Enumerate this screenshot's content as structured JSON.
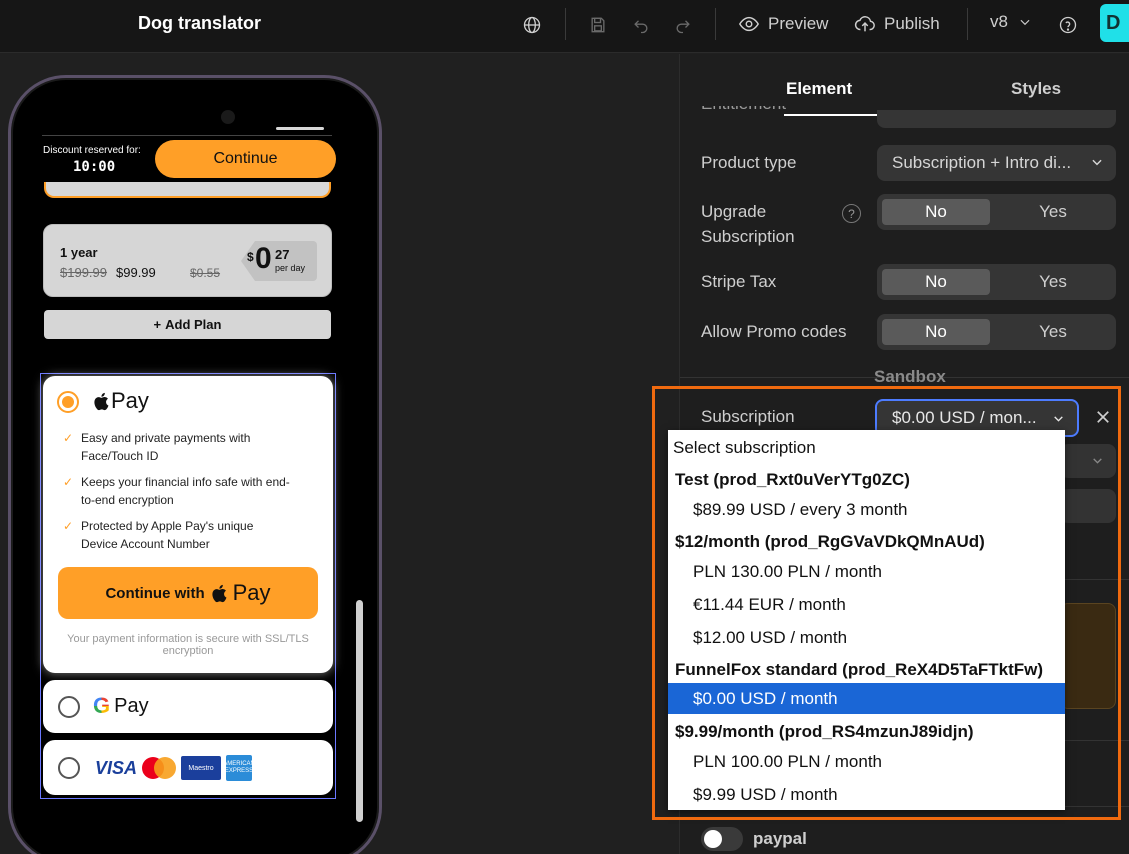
{
  "topbar": {
    "title": "Dog translator",
    "preview_label": "Preview",
    "publish_label": "Publish",
    "version": "v8",
    "avatar_initial": "D"
  },
  "phone": {
    "discount_label": "Discount reserved for:",
    "timer": "10:00",
    "continue_label": "Continue",
    "plan": {
      "name": "1 year",
      "old_price": "$199.99",
      "new_price": "$99.99",
      "old_per_day": "$0.55",
      "currency": "$",
      "price_int": "0",
      "price_dec": "27",
      "per_day": "per day"
    },
    "add_plan_label": "Add Plan",
    "apple_pay": {
      "logo_text": "Pay",
      "bullets": [
        "Easy and private payments with Face/Touch ID",
        "Keeps your financial info safe with end-to-end encryption",
        "Protected by Apple Pay's unique Device Account Number"
      ],
      "button_label": "Continue with",
      "button_pay": "Pay",
      "secure_note": "Your payment information is secure with SSL/TLS encryption"
    },
    "google_pay": {
      "logo_g": "G",
      "logo_text": "Pay"
    },
    "cards": {
      "visa": "VISA",
      "maestro": "Maestro",
      "amex": "AMERICAN EXPRESS"
    }
  },
  "panel": {
    "tabs": [
      "Element",
      "Styles"
    ],
    "cut_label": "Entitlement",
    "rows": {
      "product_type": {
        "label": "Product type",
        "value": "Subscription + Intro di..."
      },
      "upgrade": {
        "label": "Upgrade Subscription",
        "no": "No",
        "yes": "Yes"
      },
      "stripe_tax": {
        "label": "Stripe Tax",
        "no": "No",
        "yes": "Yes"
      },
      "promo": {
        "label": "Allow Promo codes",
        "no": "No",
        "yes": "Yes"
      }
    },
    "sandbox_label": "Sandbox",
    "subscription": {
      "label": "Subscription",
      "value": "$0.00 USD / mon..."
    },
    "paypal_label": "paypal"
  },
  "dropdown": {
    "items": [
      {
        "kind": "placeholder",
        "text": "Select subscription"
      },
      {
        "kind": "group",
        "text": "Test (prod_Rxt0uVerYTg0ZC)"
      },
      {
        "kind": "option",
        "text": "$89.99 USD / every 3 month"
      },
      {
        "kind": "group",
        "text": "$12/month (prod_RgGVaVDkQMnAUd)"
      },
      {
        "kind": "option",
        "text": "PLN 130.00 PLN / month"
      },
      {
        "kind": "option",
        "text": "€11.44 EUR / month"
      },
      {
        "kind": "option",
        "text": "$12.00 USD / month"
      },
      {
        "kind": "group",
        "text": "FunnelFox standard (prod_ReX4D5TaFTktFw)"
      },
      {
        "kind": "selected",
        "text": "$0.00 USD / month"
      },
      {
        "kind": "group",
        "text": "$9.99/month (prod_RS4mzunJ89idjn)"
      },
      {
        "kind": "option",
        "text": "PLN 100.00 PLN / month"
      },
      {
        "kind": "option",
        "text": "$9.99 USD / month"
      }
    ]
  },
  "colors": {
    "accent_orange": "#ff9f27",
    "highlight_frame": "#f06a0f",
    "selected_option": "#1a66d6",
    "avatar": "#20e0e8"
  }
}
